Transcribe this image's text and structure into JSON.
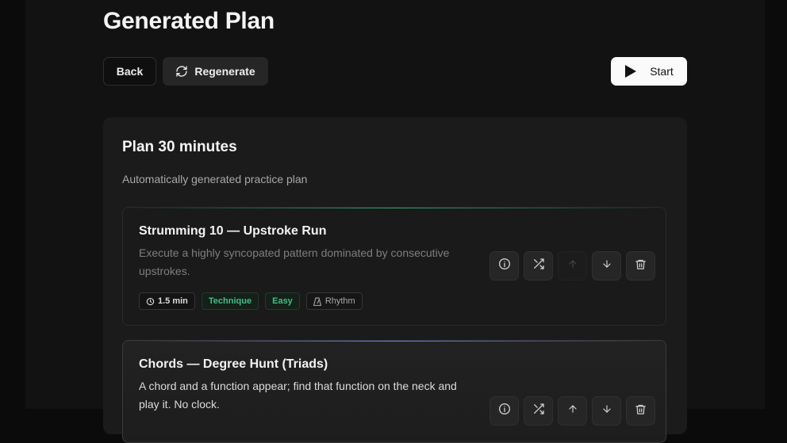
{
  "page": {
    "title": "Generated Plan"
  },
  "toolbar": {
    "back_label": "Back",
    "regenerate_label": "Regenerate",
    "start_label": "Start"
  },
  "plan": {
    "title": "Plan 30 minutes",
    "subtitle": "Automatically generated practice plan",
    "exercises": [
      {
        "title": "Strumming 10 — Upstroke Run",
        "description": "Execute a highly syncopated pattern dominated by consecutive upstrokes.",
        "duration": "1.5 min",
        "tags": [
          "Technique",
          "Easy"
        ],
        "category": "Rhythm",
        "accent": "#3cae78"
      },
      {
        "title": "Chords — Degree Hunt (Triads)",
        "description": "A chord and a function appear; find that function on the neck and play it. No clock.",
        "accent": "#5a82f0"
      }
    ]
  },
  "icons": {
    "regenerate": "refresh-icon",
    "start": "play-icon",
    "info": "info-icon",
    "shuffle": "shuffle-icon",
    "move_up": "arrow-up-icon",
    "move_down": "arrow-down-icon",
    "delete": "trash-icon",
    "duration": "clock-icon",
    "category": "metronome-icon"
  }
}
